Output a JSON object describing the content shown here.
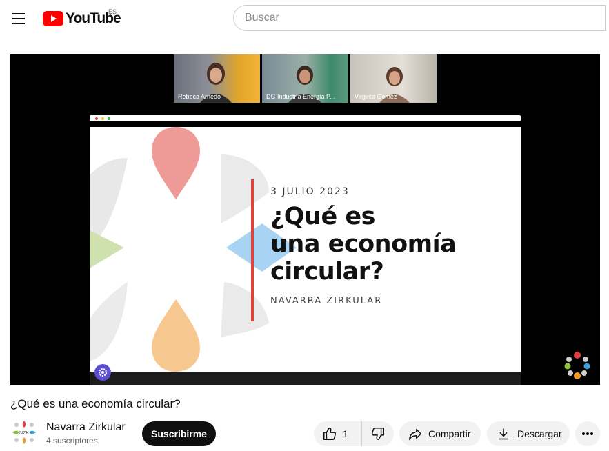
{
  "header": {
    "menu_icon": "hamburger-icon",
    "logo_text": "YouTube",
    "country_code": "ES",
    "search_placeholder": "Buscar"
  },
  "player": {
    "participants": [
      {
        "name": "Rebeca Arnedo"
      },
      {
        "name": "DG Industria Energía P..."
      },
      {
        "name": "Virginia Gómez"
      }
    ],
    "slide": {
      "date": "3 JULIO 2023",
      "title": "¿Qué es\nuna economía\ncircular?",
      "organization": "NAVARRA ZIRKULAR"
    }
  },
  "video": {
    "title": "¿Qué es una economía circular?"
  },
  "channel": {
    "name": "Navarra Zirkular",
    "subscribers": "4 suscriptores",
    "avatar_text": "NZK",
    "subscribe_label": "Suscribirme"
  },
  "actions": {
    "like_count": "1",
    "share_label": "Compartir",
    "download_label": "Descargar"
  },
  "colors": {
    "youtube_red": "#ff0000",
    "slide_line": "#e0413a",
    "petal_red": "#ee9b97",
    "petal_blue": "#a9d3f2",
    "petal_green": "#cfe1ae",
    "petal_orange": "#f6c88f",
    "petal_gray": "#e6e6e6"
  }
}
